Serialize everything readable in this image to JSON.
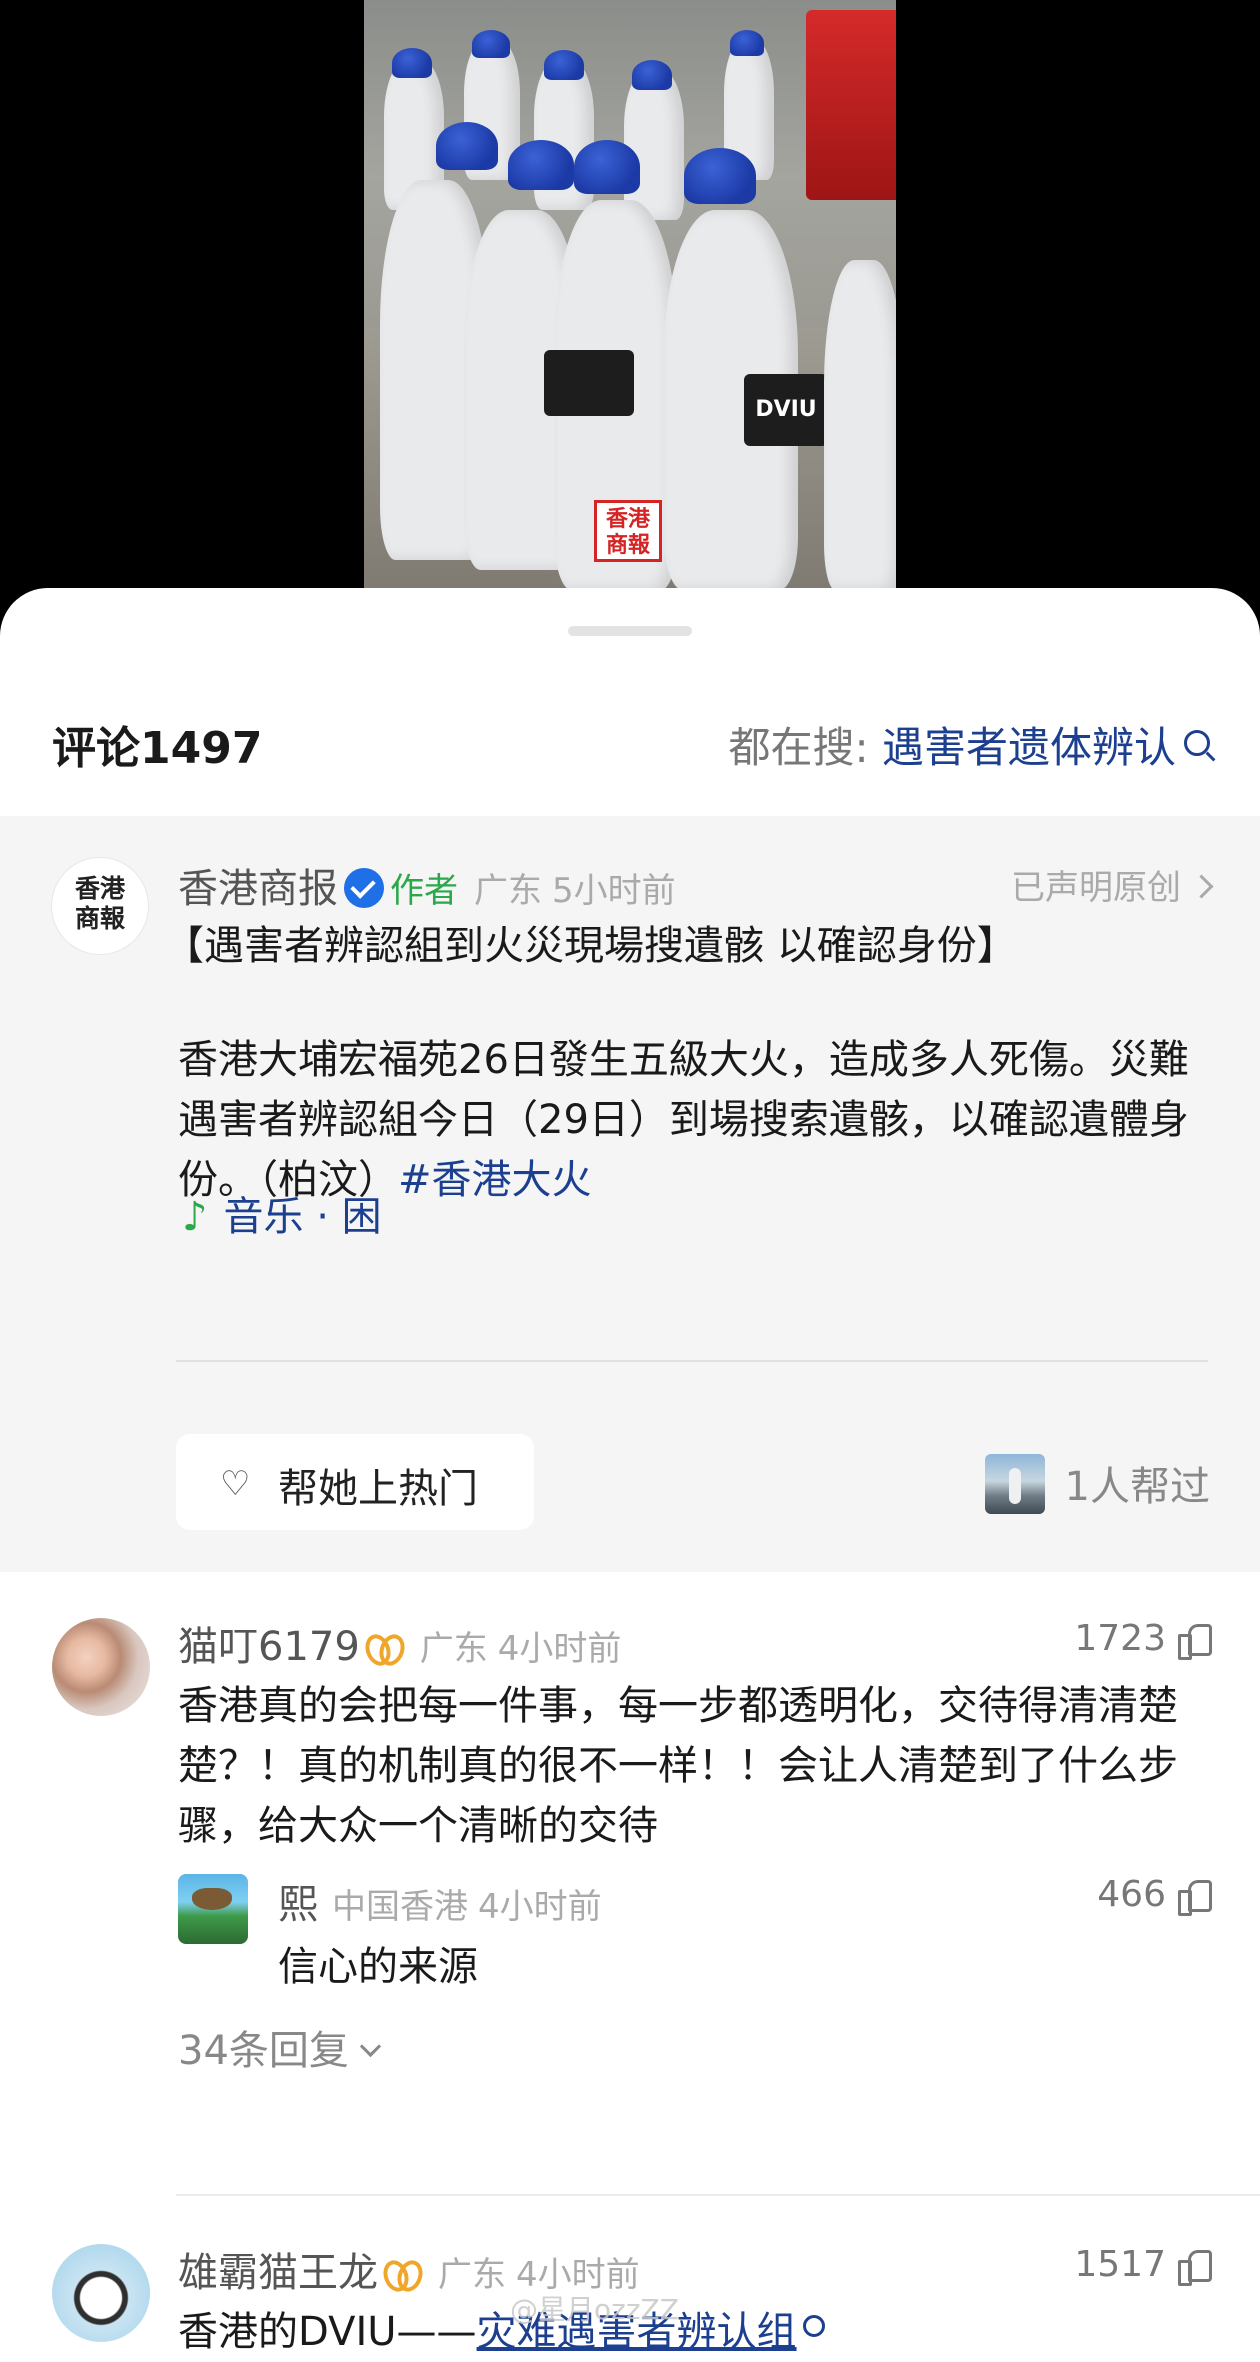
{
  "video": {
    "watermark_logo": "香港商報",
    "vest_text": "DVIU"
  },
  "sheet_header": {
    "comment_count": "评论1497",
    "hot_search_label": "都在搜:",
    "hot_search_keyword": "遇害者遗体辨认"
  },
  "post": {
    "avatar_text": [
      "香港",
      "商報"
    ],
    "author_name": "香港商报",
    "author_tag": "作者",
    "location": "广东",
    "time": "5小时前",
    "original_claim": "已声明原创",
    "title": "【遇害者辨認組到火災現場搜遺骸 以確認身份】",
    "body": "香港大埔宏福苑26日發生五級大火，造成多人死傷。災難遇害者辨認組今日（29日）到場搜索遺骸，以確認遺體身份。（柏汶）",
    "hashtag": "#香港大火",
    "music": "音乐 · 困",
    "boost_button": "帮她上热门",
    "helped_count": "1人帮过"
  },
  "comments": [
    {
      "user": "猫叮6179",
      "location": "广东",
      "time": "4小时前",
      "likes": "1723",
      "text": "香港真的会把每一件事，每一步都透明化，交待得清清楚楚？！真的机制真的很不一样！！会让人清楚到了什么步骤，给大众一个清晰的交待",
      "reply": {
        "user": "熙",
        "location": "中国香港",
        "time": "4小时前",
        "likes": "466",
        "text": "信心的来源"
      },
      "more_replies": "34条回复"
    },
    {
      "user": "雄霸猫王龙",
      "location": "广东",
      "time": "4小时前",
      "likes": "1517",
      "text_prefix": "香港的DVIU——",
      "text_link": "灾难遇害者辨认组"
    }
  ],
  "footer_watermark": "@星月ozzZZ",
  "colors": {
    "link_blue": "#1d3f8f",
    "author_green": "#2ba84a",
    "verified_blue": "#1f6fe6",
    "vip_gold": "#f0a62a"
  }
}
